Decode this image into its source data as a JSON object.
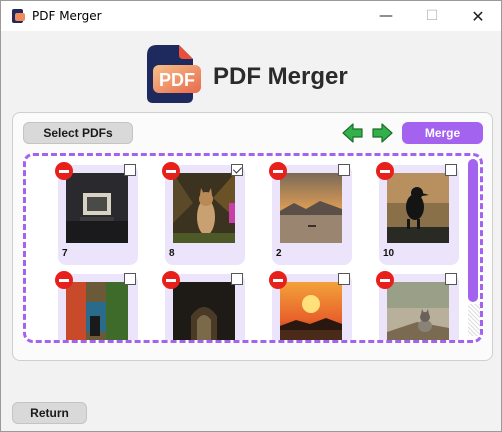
{
  "window": {
    "title": "PDF Merger",
    "minimize_glyph": "—",
    "maximize_glyph": "☐",
    "close_glyph": "✕"
  },
  "header": {
    "title": "PDF Merger",
    "logo_text": "PDF"
  },
  "toolbar": {
    "select_label": "Select PDFs",
    "merge_label": "Merge",
    "accent_color": "#a463ef"
  },
  "files": [
    {
      "label": "7",
      "checked": false,
      "thumb": "framed-picture"
    },
    {
      "label": "8",
      "checked": true,
      "thumb": "cat-in-grass"
    },
    {
      "label": "2",
      "checked": false,
      "thumb": "sunset-sea"
    },
    {
      "label": "10",
      "checked": false,
      "thumb": "crow-silhouette"
    },
    {
      "label": "",
      "checked": false,
      "thumb": "colorful-street"
    },
    {
      "label": "",
      "checked": false,
      "thumb": "dark-doorway"
    },
    {
      "label": "",
      "checked": false,
      "thumb": "orange-sunset"
    },
    {
      "label": "",
      "checked": false,
      "thumb": "cat-on-rock"
    }
  ],
  "footer": {
    "return_label": "Return"
  }
}
